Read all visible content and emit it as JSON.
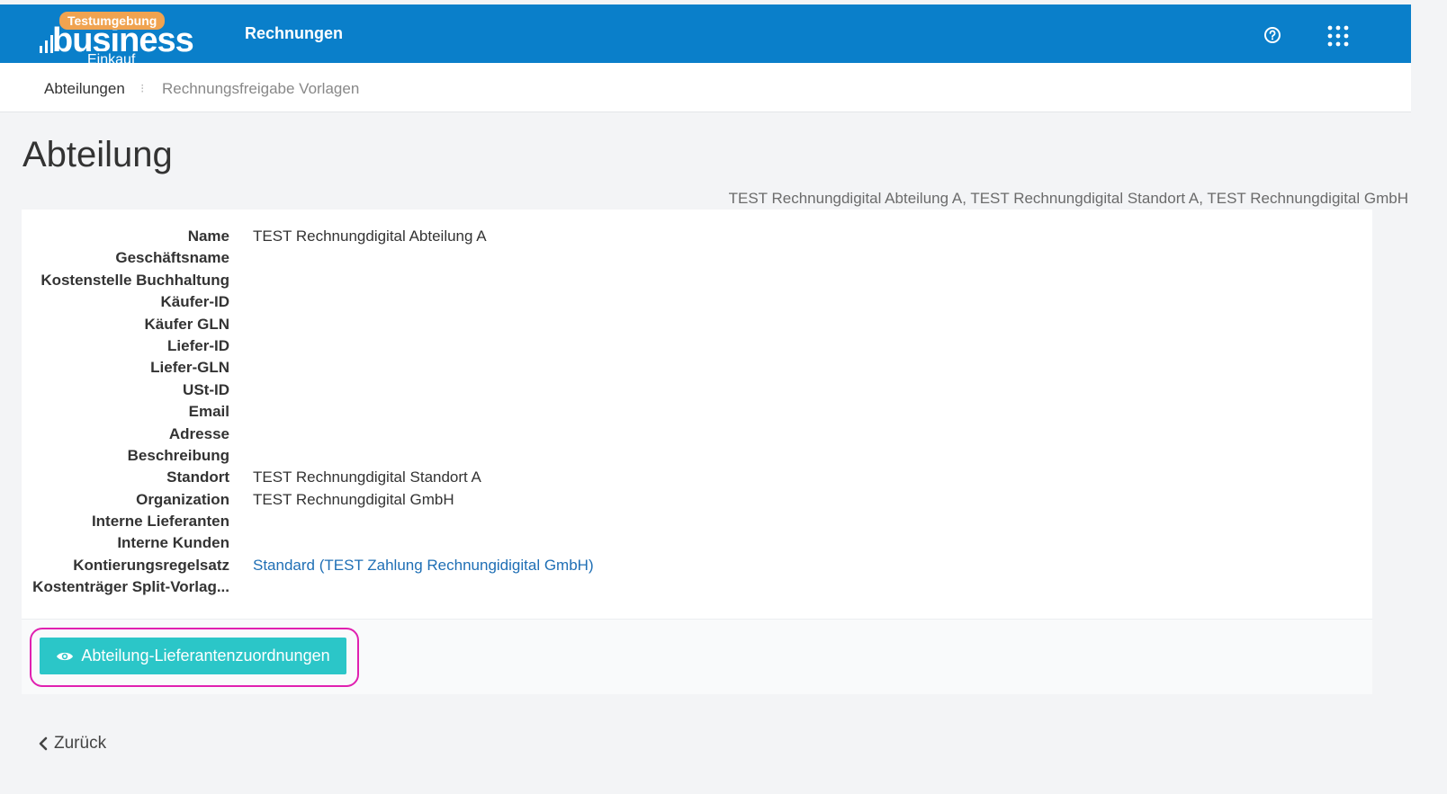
{
  "header": {
    "logo_badge": "Testumgebung",
    "logo_word": "business",
    "logo_sub": "Einkauf",
    "app_title": "Rechnungen",
    "help_icon": "help-circle-icon",
    "apps_icon": "apps-grid-icon",
    "bg_color": "#0a7fca",
    "badge_color": "#f0a350"
  },
  "subnav": {
    "items": [
      {
        "label": "Abteilungen"
      },
      {
        "label": "Rechnungsfreigabe Vorlagen"
      }
    ]
  },
  "page": {
    "title": "Abteilung",
    "context": "TEST Rechnungdigital Abteilung A, TEST Rechnungdigital Standort A, TEST Rechnungdigital GmbH"
  },
  "fields": [
    {
      "label": "Name",
      "value": "TEST Rechnungdigital Abteilung A"
    },
    {
      "label": "Geschäftsname",
      "value": ""
    },
    {
      "label": "Kostenstelle Buchhaltung",
      "value": ""
    },
    {
      "label": "Käufer-ID",
      "value": ""
    },
    {
      "label": "Käufer GLN",
      "value": ""
    },
    {
      "label": "Liefer-ID",
      "value": ""
    },
    {
      "label": "Liefer-GLN",
      "value": ""
    },
    {
      "label": "USt-ID",
      "value": ""
    },
    {
      "label": "Email",
      "value": ""
    },
    {
      "label": "Adresse",
      "value": ""
    },
    {
      "label": "Beschreibung",
      "value": ""
    },
    {
      "label": "Standort",
      "value": "TEST Rechnungdigital Standort A"
    },
    {
      "label": "Organization",
      "value": "TEST Rechnungdigital GmbH"
    },
    {
      "label": "Interne Lieferanten",
      "value": ""
    },
    {
      "label": "Interne Kunden",
      "value": ""
    },
    {
      "label": "Kontierungsregelsatz",
      "value": "Standard (TEST Zahlung Rechnungidigital GmbH)",
      "link": true
    },
    {
      "label": "Kostenträger Split-Vorlag...",
      "value": ""
    }
  ],
  "actions": {
    "supplier_assignments_label": "Abteilung-Lieferantenzuordnungen",
    "supplier_assignments_icon": "eye-icon",
    "button_color": "#2bc6c8",
    "highlight_color": "#e020b0"
  },
  "footer": {
    "back_label": "Zurück",
    "back_icon": "chevron-left-icon"
  }
}
